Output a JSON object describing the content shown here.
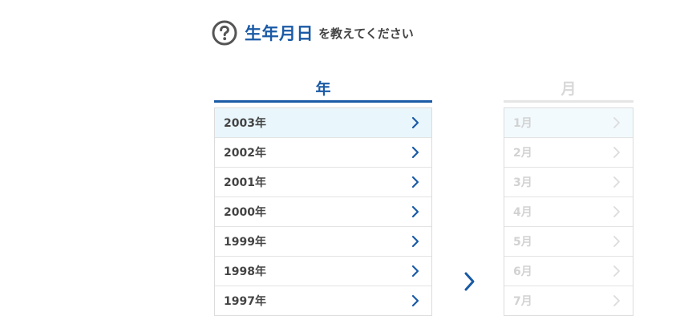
{
  "heading": {
    "title": "生年月日",
    "subtitle": "を教えてください",
    "icon": "question-circle-icon"
  },
  "year_column": {
    "header": "年",
    "accent_color": "#1a5aa6",
    "selected_index": 0,
    "items": [
      {
        "label": "2003年"
      },
      {
        "label": "2002年"
      },
      {
        "label": "2001年"
      },
      {
        "label": "2000年"
      },
      {
        "label": "1999年"
      },
      {
        "label": "1998年"
      },
      {
        "label": "1997年"
      }
    ]
  },
  "month_column": {
    "header": "月",
    "disabled": true,
    "items": [
      {
        "label": "1月"
      },
      {
        "label": "2月"
      },
      {
        "label": "3月"
      },
      {
        "label": "4月"
      },
      {
        "label": "5月"
      },
      {
        "label": "6月"
      },
      {
        "label": "7月"
      }
    ]
  },
  "next_arrow_icon": "chevron-right-icon"
}
